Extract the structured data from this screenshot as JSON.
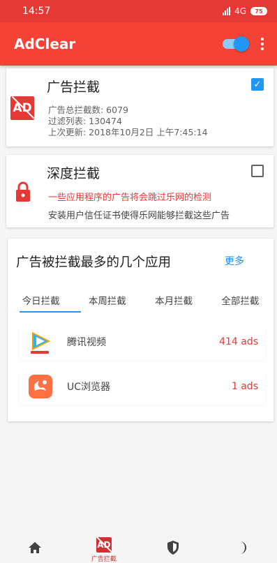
{
  "status_bar": {
    "time": "14:57",
    "network": "4G",
    "battery": "75"
  },
  "app_bar": {
    "title": "AdClear",
    "toggle_on": true
  },
  "ad_block": {
    "title": "广告拦截",
    "checked": true,
    "total_blocked": "广告总拦截数: 6079",
    "filter_list": "过滤列表: 130474",
    "last_update": "上次更新: 2018年10月2日 上午7:45:14"
  },
  "deep_block": {
    "title": "深度拦截",
    "checked": false,
    "warning": "一些应用程序的广告将会跳过乐网的检测",
    "description": "安装用户信任证书使得乐网能够拦截这些广告"
  },
  "top_apps": {
    "title": "广告被拦截最多的几个应用",
    "more": "更多",
    "tabs": [
      "今日拦截",
      "本周拦截",
      "本月拦截",
      "全部拦截"
    ],
    "active_tab": 0,
    "apps": [
      {
        "name": "腾讯视频",
        "count": "414 ads",
        "icon": "tencent-video-icon"
      },
      {
        "name": "UC浏览器",
        "count": "1 ads",
        "icon": "uc-browser-icon"
      }
    ]
  },
  "bottom_nav": {
    "items": [
      {
        "icon": "home-icon"
      },
      {
        "icon": "ad-block-icon",
        "label": "广告拦截",
        "active": true
      },
      {
        "icon": "shield-icon"
      },
      {
        "icon": "moon-icon"
      }
    ]
  },
  "colors": {
    "primary": "#f44336",
    "accent": "#2196f3",
    "warning": "#e53935"
  }
}
